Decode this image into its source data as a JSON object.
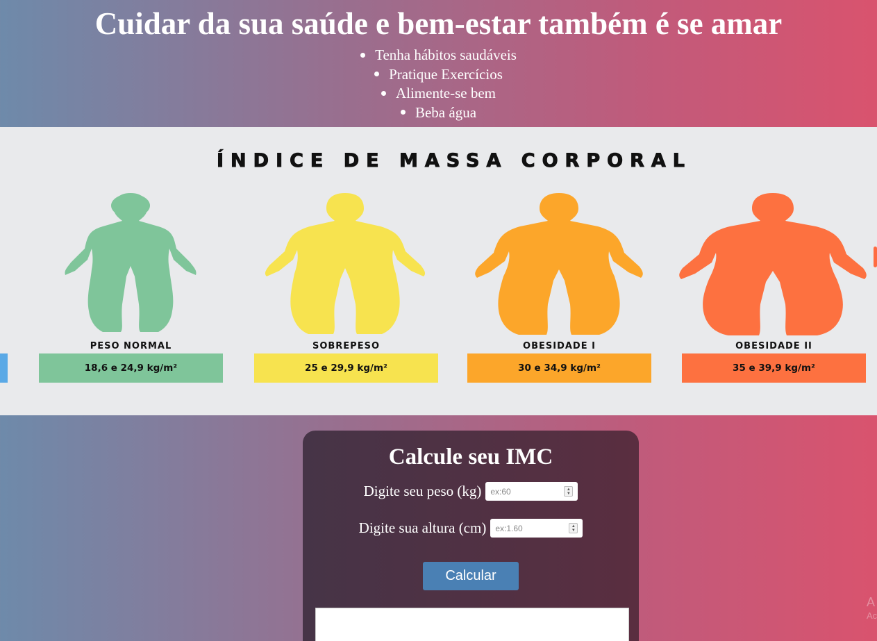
{
  "header": {
    "title": "Cuidar da sua saúde e bem-estar também é se amar",
    "tips": [
      "Tenha hábitos saudáveis",
      "Pratique Exercícios",
      "Alimente-se bem",
      "Beba água"
    ]
  },
  "banner": {
    "title": "ÍNDICE DE MASSA CORPORAL",
    "categories": [
      {
        "label": "PESO NORMAL",
        "range": "18,6 e 24,9 kg/m²",
        "color": "#7fc59a"
      },
      {
        "label": "SOBREPESO",
        "range": "25 e 29,9 kg/m²",
        "color": "#f7e34f"
      },
      {
        "label": "OBESIDADE I",
        "range": "30 e 34,9 kg/m²",
        "color": "#fca62a"
      },
      {
        "label": "OBESIDADE II",
        "range": "35 e 39,9 kg/m²",
        "color": "#fd7140"
      }
    ]
  },
  "calculator": {
    "title": "Calcule seu IMC",
    "weight_label": "Digite seu peso (kg)",
    "weight_placeholder": "ex:60",
    "height_label": "Digite sua altura (cm)",
    "height_placeholder": "ex:1.60",
    "button_label": "Calcular",
    "result": ""
  },
  "watermark": {
    "line1": "A",
    "line2": "Ac"
  },
  "colors": {
    "button": "#4a80b4",
    "card": "#4f3144"
  }
}
